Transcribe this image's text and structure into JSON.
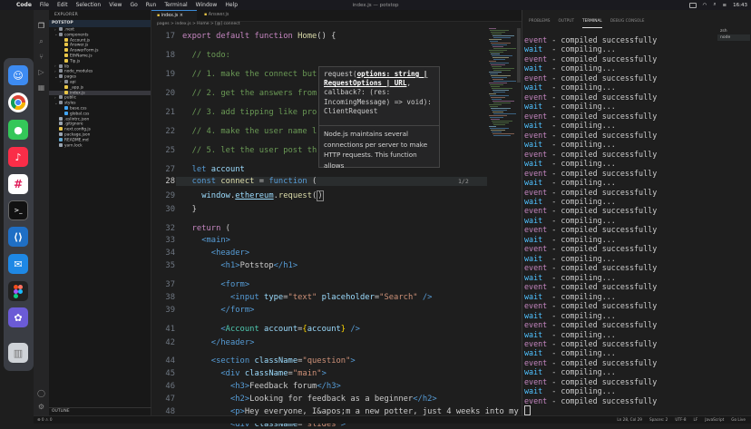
{
  "menubar": {
    "app": "Code",
    "items": [
      "File",
      "Edit",
      "Selection",
      "View",
      "Go",
      "Run",
      "Terminal",
      "Window",
      "Help"
    ],
    "window_title": "index.js — potstop",
    "clock": "16:43"
  },
  "explorer": {
    "header": "EXPLORER",
    "project": "POTSTOP",
    "files": [
      {
        "name": ".next",
        "depth": 1,
        "folder": true,
        "open": false
      },
      {
        "name": "components",
        "depth": 1,
        "folder": true,
        "open": true
      },
      {
        "name": "Account.js",
        "depth": 2,
        "folder": false
      },
      {
        "name": "Answer.js",
        "depth": 2,
        "folder": false
      },
      {
        "name": "AnswerForm.js",
        "depth": 2,
        "folder": false
      },
      {
        "name": "EthName.js",
        "depth": 2,
        "folder": false
      },
      {
        "name": "Tip.js",
        "depth": 2,
        "folder": false
      },
      {
        "name": "lib",
        "depth": 1,
        "folder": true,
        "open": false
      },
      {
        "name": "node_modules",
        "depth": 1,
        "folder": true,
        "open": false
      },
      {
        "name": "pages",
        "depth": 1,
        "folder": true,
        "open": true
      },
      {
        "name": "api",
        "depth": 2,
        "folder": true,
        "open": false
      },
      {
        "name": "_app.js",
        "depth": 2,
        "folder": false
      },
      {
        "name": "index.js",
        "depth": 2,
        "folder": false
      },
      {
        "name": "public",
        "depth": 1,
        "folder": true,
        "open": false
      },
      {
        "name": "styles",
        "depth": 1,
        "folder": true,
        "open": true
      },
      {
        "name": "base.css",
        "depth": 2,
        "folder": false
      },
      {
        "name": "global.css",
        "depth": 2,
        "folder": false
      },
      {
        "name": ".eslintrc.json",
        "depth": 1,
        "folder": false
      },
      {
        "name": ".gitignore",
        "depth": 1,
        "folder": false
      },
      {
        "name": "next.config.js",
        "depth": 1,
        "folder": false
      },
      {
        "name": "package.json",
        "depth": 1,
        "folder": false
      },
      {
        "name": "README.md",
        "depth": 1,
        "folder": false
      },
      {
        "name": "yarn.lock",
        "depth": 1,
        "folder": false
      }
    ],
    "outline": "OUTLINE"
  },
  "editor": {
    "tabs": [
      "index.js",
      "Answer.js"
    ],
    "breadcrumb": "pages > index.js > Home > [@] connect",
    "hover": {
      "sig_prefix": "request(",
      "sig_param": "options: string | RequestOptions | URL",
      "sig_rest": ", callback?: (res: IncomingMessage) => void): ClientRequest",
      "doc": "Node.js maintains several connections per server to make HTTP requests. This function allows",
      "counter": "1/2"
    }
  },
  "panel": {
    "tabs": [
      "PROBLEMS",
      "OUTPUT",
      "TERMINAL",
      "DEBUG CONSOLE"
    ],
    "active_tab": "TERMINAL",
    "term_list": [
      "zsh",
      "node"
    ],
    "line_a_label": "event",
    "line_a_text": " - compiled successfully",
    "line_b_label": "wait",
    "line_b_text": "  - compiling..."
  },
  "status": {
    "left": "⊗ 0 ⚠ 0",
    "items": [
      "Ln 28, Col 29",
      "Spaces: 2",
      "UTF-8",
      "LF",
      "JavaScript",
      "Go Live"
    ]
  }
}
